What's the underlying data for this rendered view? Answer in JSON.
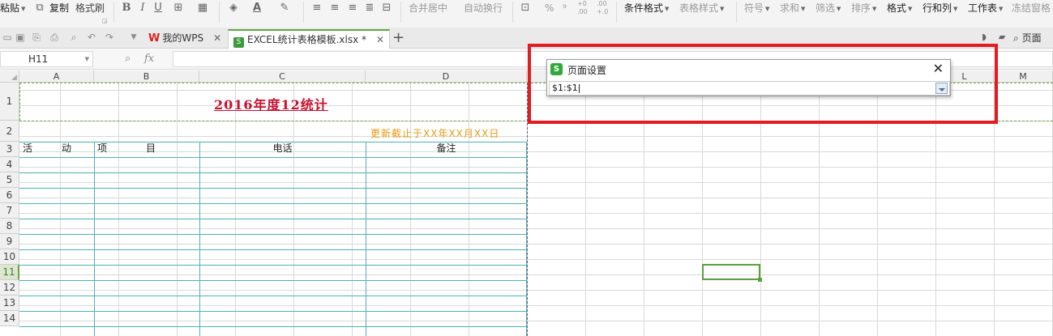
{
  "ribbon": {
    "paste": "粘贴",
    "copy": "复制",
    "format_painter": "格式刷",
    "bold": "B",
    "italic": "I",
    "underline": "U",
    "font_color": "A",
    "merge_center": "合并居中",
    "auto_wrap": "自动换行",
    "percent": "%",
    "thousands": "⁹",
    "increase_decimal": "+0 .00",
    "decrease_decimal": ".00 +.0",
    "conditional_format": "条件格式",
    "table_style": "表格样式",
    "symbol": "符号",
    "sum": "求和",
    "filter": "筛选",
    "sort": "排序",
    "format": "格式",
    "rows_cols": "行和列",
    "worksheet": "工作表",
    "freeze_panes": "冻结窗格"
  },
  "tabs": [
    {
      "label": "我的WPS",
      "active": false
    },
    {
      "label": "EXCEL统计表格模板.xlsx *",
      "active": true
    }
  ],
  "tabbar": {
    "search_label": "页面"
  },
  "formula_bar": {
    "cell_ref": "H11",
    "fx_label": "fx",
    "content": ""
  },
  "columns": [
    "A",
    "B",
    "C",
    "D",
    "L",
    "M"
  ],
  "rows": [
    "1",
    "2",
    "3",
    "4",
    "5",
    "6",
    "7",
    "8",
    "9",
    "10",
    "11",
    "12",
    "13",
    "14"
  ],
  "selected_row": "11",
  "sheet": {
    "title": "2016年度12统计",
    "subtitle": "更新截止于XX年XX月XX日",
    "headers": [
      "活　　　动",
      "项　　　　目",
      "电话",
      "备注"
    ]
  },
  "dialog": {
    "title": "页面设置",
    "input_value": "$1:$1",
    "close_label": "✕"
  },
  "colors": {
    "accent_green": "#6ca443",
    "highlight_red": "#e31b23",
    "title_red": "#c8102e",
    "subtitle_orange": "#e89b0f",
    "table_border": "#4db0b9"
  }
}
